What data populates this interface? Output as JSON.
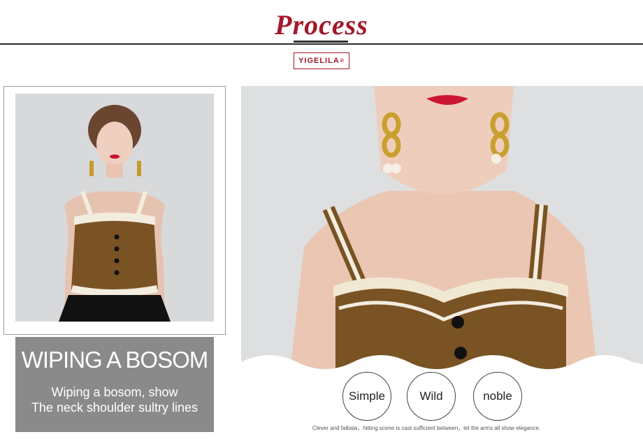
{
  "header": {
    "title": "Process",
    "brand": "YIGELILA",
    "brand_mark": "®"
  },
  "feature": {
    "heading": "WIPING A BOSOM",
    "subline1": "Wiping a bosom, show",
    "subline2": "The neck shoulder sultry lines"
  },
  "tags": [
    "Simple",
    "Wild",
    "noble"
  ],
  "caption": "Clever and falbala，hitting scene is cast sufficient between，let the arms all show elegance.",
  "colors": {
    "accent": "#a3182a",
    "knit": "#7a5324",
    "trim": "#f3ede0",
    "panel": "#8a8a8a"
  }
}
